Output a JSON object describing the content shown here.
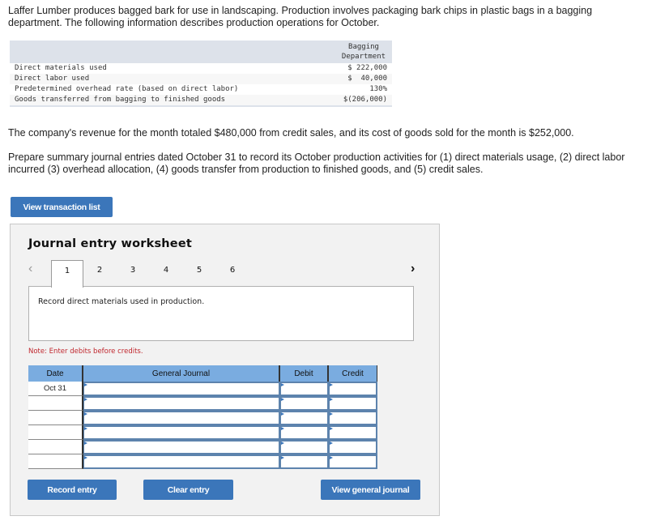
{
  "intro": "Laffer Lumber produces bagged bark for use in landscaping. Production involves packaging bark chips in plastic bags in a bagging department. The following information describes production operations for October.",
  "info_table": {
    "header": [
      "",
      "Bagging\nDepartment"
    ],
    "header_line1": "Bagging",
    "header_line2": "Department",
    "rows": [
      {
        "label": "Direct materials used",
        "value": "$ 222,000"
      },
      {
        "label": "Direct labor used",
        "value": "$  40,000"
      },
      {
        "label": "Predetermined overhead rate (based on direct labor)",
        "value": "130%"
      },
      {
        "label": "Goods transferred from bagging to finished goods",
        "value": "$(206,000)"
      }
    ]
  },
  "paragraph1": "The company's revenue for the month totaled $480,000 from credit sales, and its cost of goods sold for the month is $252,000.",
  "paragraph2": "Prepare summary journal entries dated October 31 to record its October production activities for (1) direct materials usage, (2) direct labor incurred (3) overhead allocation, (4) goods transfer from production to finished goods, and (5) credit sales.",
  "buttons": {
    "view_transaction_list": "View transaction list",
    "record_entry": "Record entry",
    "clear_entry": "Clear entry",
    "view_general_journal": "View general journal"
  },
  "worksheet": {
    "title": "Journal entry worksheet",
    "prev_icon": "chevron-left-icon",
    "next_icon": "chevron-right-icon",
    "tabs": [
      "1",
      "2",
      "3",
      "4",
      "5",
      "6"
    ],
    "active_tab": "1",
    "description": "Record direct materials used in production.",
    "note": "Note: Enter debits before credits.",
    "columns": [
      "Date",
      "General Journal",
      "Debit",
      "Credit"
    ],
    "rows": [
      {
        "date": "Oct 31",
        "account": "",
        "debit": "",
        "credit": ""
      },
      {
        "date": "",
        "account": "",
        "debit": "",
        "credit": ""
      },
      {
        "date": "",
        "account": "",
        "debit": "",
        "credit": ""
      },
      {
        "date": "",
        "account": "",
        "debit": "",
        "credit": ""
      },
      {
        "date": "",
        "account": "",
        "debit": "",
        "credit": ""
      },
      {
        "date": "",
        "account": "",
        "debit": "",
        "credit": ""
      }
    ]
  },
  "colors": {
    "button_blue": "#3b76ba",
    "table_header_blue": "#7aace0",
    "note_red": "#c0262d",
    "panel_gray": "#f2f2f2"
  }
}
